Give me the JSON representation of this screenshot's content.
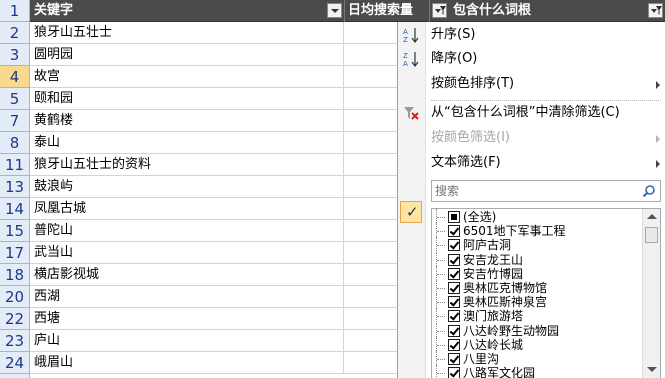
{
  "sheet": {
    "header": {
      "row_number": "1",
      "col_a": "关键字",
      "col_b": "日均搜索量",
      "col_c": "包含什么词根"
    },
    "rows": [
      {
        "num": "2",
        "keyword": "狼牙山五壮士"
      },
      {
        "num": "3",
        "keyword": "圆明园"
      },
      {
        "num": "4",
        "keyword": "故宫"
      },
      {
        "num": "5",
        "keyword": "颐和园"
      },
      {
        "num": "7",
        "keyword": "黄鹤楼"
      },
      {
        "num": "8",
        "keyword": "泰山"
      },
      {
        "num": "11",
        "keyword": "狼牙山五壮士的资料"
      },
      {
        "num": "13",
        "keyword": "鼓浪屿"
      },
      {
        "num": "14",
        "keyword": "凤凰古城"
      },
      {
        "num": "15",
        "keyword": "普陀山"
      },
      {
        "num": "17",
        "keyword": "武当山"
      },
      {
        "num": "18",
        "keyword": "横店影视城"
      },
      {
        "num": "20",
        "keyword": "西湖"
      },
      {
        "num": "22",
        "keyword": "西塘"
      },
      {
        "num": "23",
        "keyword": "庐山"
      },
      {
        "num": "24",
        "keyword": "峨眉山"
      }
    ],
    "active_row": "4"
  },
  "menu": {
    "sort_asc": "升序(S)",
    "sort_desc": "降序(O)",
    "sort_by_color": "按颜色排序(T)",
    "clear_filter": "从“包含什么词根”中清除筛选(C)",
    "filter_by_color": "按颜色筛选(I)",
    "text_filter": "文本筛选(F)",
    "search_placeholder": "搜索",
    "items": [
      {
        "label": "(全选)",
        "state": "partial"
      },
      {
        "label": "6501地下军事工程",
        "state": "checked"
      },
      {
        "label": "阿庐古洞",
        "state": "checked"
      },
      {
        "label": "安吉龙王山",
        "state": "checked"
      },
      {
        "label": "安吉竹博园",
        "state": "checked"
      },
      {
        "label": "奥林匹克博物馆",
        "state": "checked"
      },
      {
        "label": "奥林匹斯神泉宫",
        "state": "checked"
      },
      {
        "label": "澳门旅游塔",
        "state": "checked"
      },
      {
        "label": "八达岭野生动物园",
        "state": "checked"
      },
      {
        "label": "八达岭长城",
        "state": "checked"
      },
      {
        "label": "八里沟",
        "state": "checked"
      },
      {
        "label": "八路军文化园",
        "state": "checked"
      }
    ]
  },
  "colors": {
    "header_bg": "#4b4b4b",
    "row_header_bg": "#e4ecf7",
    "row_number_color": "#1d3a8a",
    "active_row_bg": "#f9d98f",
    "menu_gutter": "#f3f3f3"
  }
}
